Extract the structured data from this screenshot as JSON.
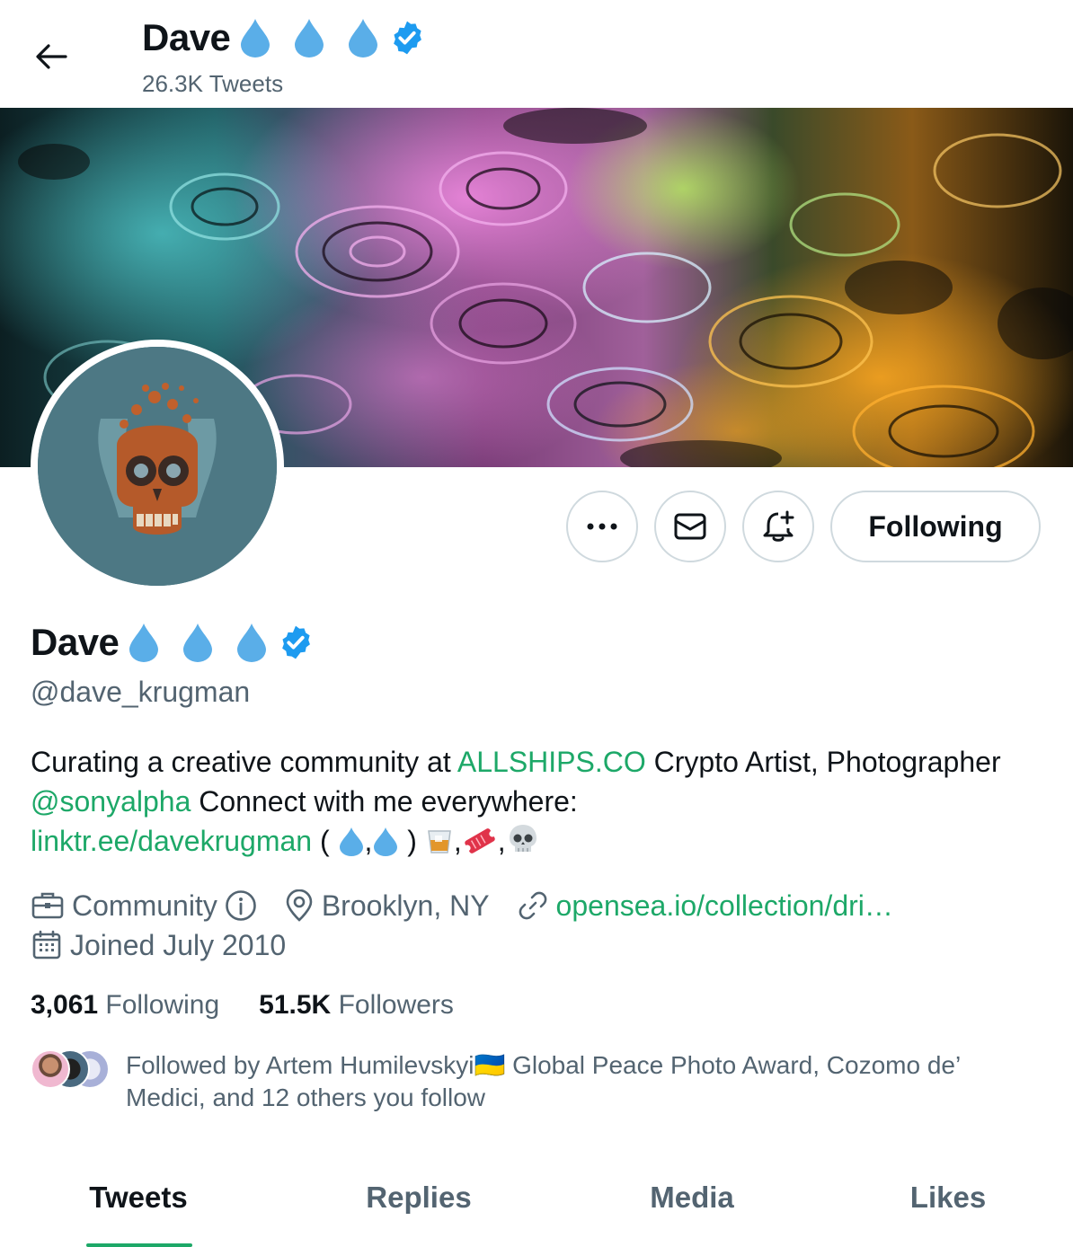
{
  "header": {
    "name": "Dave",
    "tweet_count": "26.3K Tweets"
  },
  "actions": {
    "following_label": "Following"
  },
  "profile": {
    "name": "Dave",
    "handle": "@dave_krugman",
    "bio": {
      "part1": "Curating a creative community at ",
      "link1": "ALLSHIPS.CO",
      "part2": " Crypto Artist, Photographer ",
      "link2": "@sonyalpha",
      "part3": " Connect with me everywhere: ",
      "link3": "linktr.ee/davekrugman",
      "part4": " ( ",
      "sep": ",",
      "part5": " ) "
    },
    "category": "Community",
    "location": "Brooklyn, NY",
    "website": "opensea.io/collection/dri…",
    "joined": "Joined July 2010"
  },
  "stats": {
    "following_count": "3,061",
    "following_label": "Following",
    "followers_count": "51.5K",
    "followers_label": "Followers"
  },
  "followed_by": "Followed by Artem Humilevskyi🇺🇦 Global Peace Photo Award, Cozomo de’ Medici, and 12 others you follow",
  "tabs": [
    "Tweets",
    "Replies",
    "Media",
    "Likes"
  ],
  "colors": {
    "accent": "#1da868",
    "verified": "#1d9bf0",
    "drop": "#5aaee8",
    "muted": "#536471"
  }
}
